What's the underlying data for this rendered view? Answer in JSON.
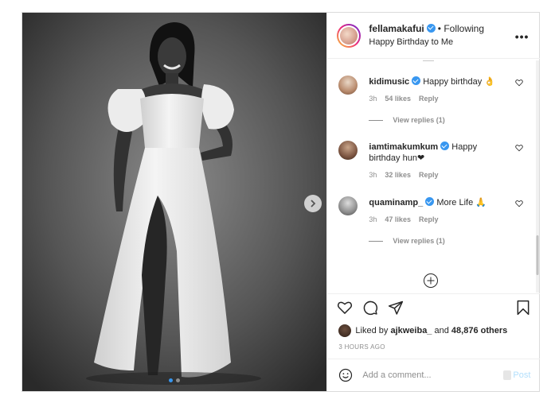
{
  "post": {
    "username": "fellamakafui",
    "follow_status": "• Following",
    "caption": "Happy Birthday to Me",
    "more_icon": "more-horizontal-icon"
  },
  "comments": [
    {
      "user": "kidimusic",
      "verified": true,
      "text": "Happy birthday 👌",
      "time": "3h",
      "likes": "54 likes",
      "reply_label": "Reply",
      "view_replies": "View replies (1)"
    },
    {
      "user": "iamtimakumkum",
      "verified": true,
      "text": "Happy birthday hun❤",
      "time": "3h",
      "likes": "32 likes",
      "reply_label": "Reply",
      "view_replies": ""
    },
    {
      "user": "quaminamp_",
      "verified": true,
      "text": "More Life 🙏",
      "time": "3h",
      "likes": "47 likes",
      "reply_label": "Reply",
      "view_replies": "View replies (1)"
    }
  ],
  "actions": {
    "icons": [
      "heart-icon",
      "comment-icon",
      "share-icon",
      "bookmark-icon"
    ],
    "liked_by_prefix": "Liked by",
    "liked_by_user": "ajkweiba_",
    "liked_by_suffix": "and",
    "others": "48,876 others",
    "time_ago": "3 HOURS AGO"
  },
  "add_comment": {
    "placeholder": "Add a comment...",
    "post_label": "Post"
  },
  "carousel": {
    "slides": 2,
    "current": 1
  },
  "colors": {
    "accent": "#3897f0",
    "post_disabled": "#b2dffc",
    "muted": "#8e8e8e",
    "border": "#dbdbdb"
  }
}
